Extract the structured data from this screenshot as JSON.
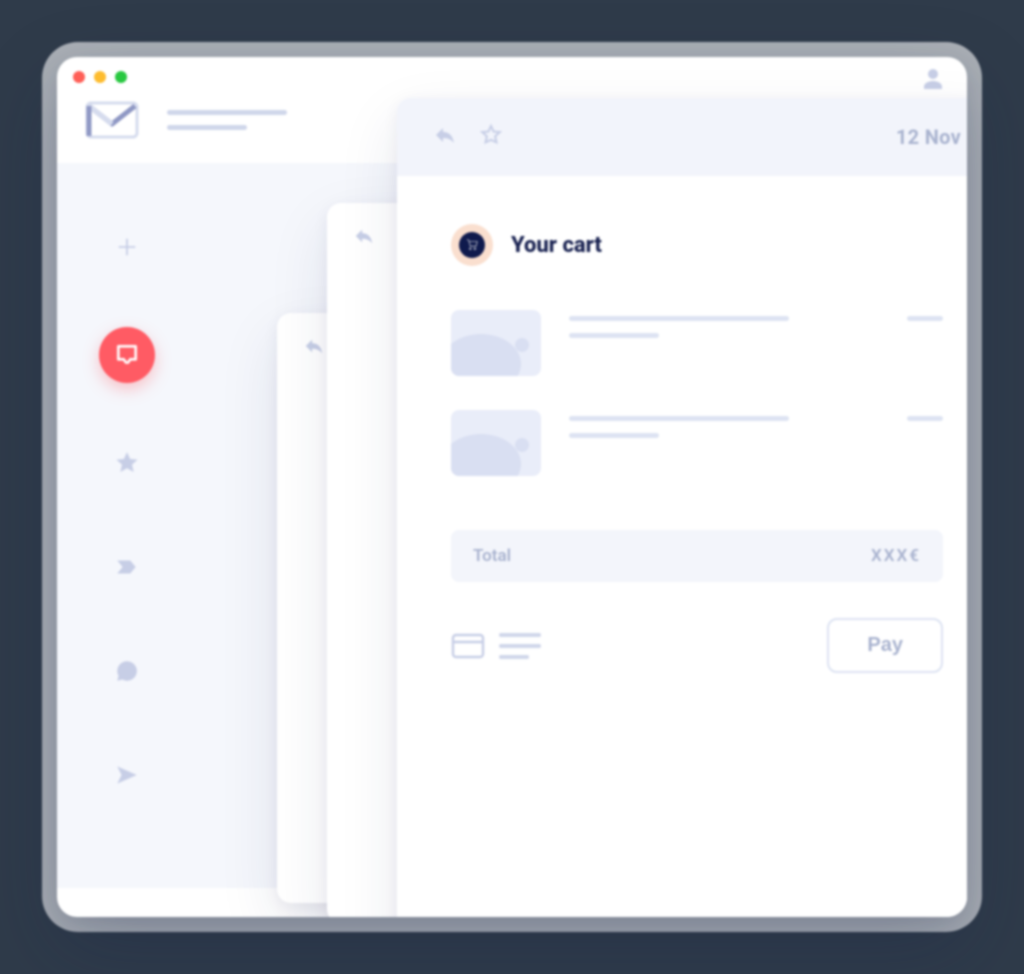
{
  "email_card": {
    "date": "12 Nov",
    "cart": {
      "heading": "Your cart",
      "total_label": "Total",
      "total_amount": "XXX€",
      "pay_label": "Pay"
    }
  }
}
